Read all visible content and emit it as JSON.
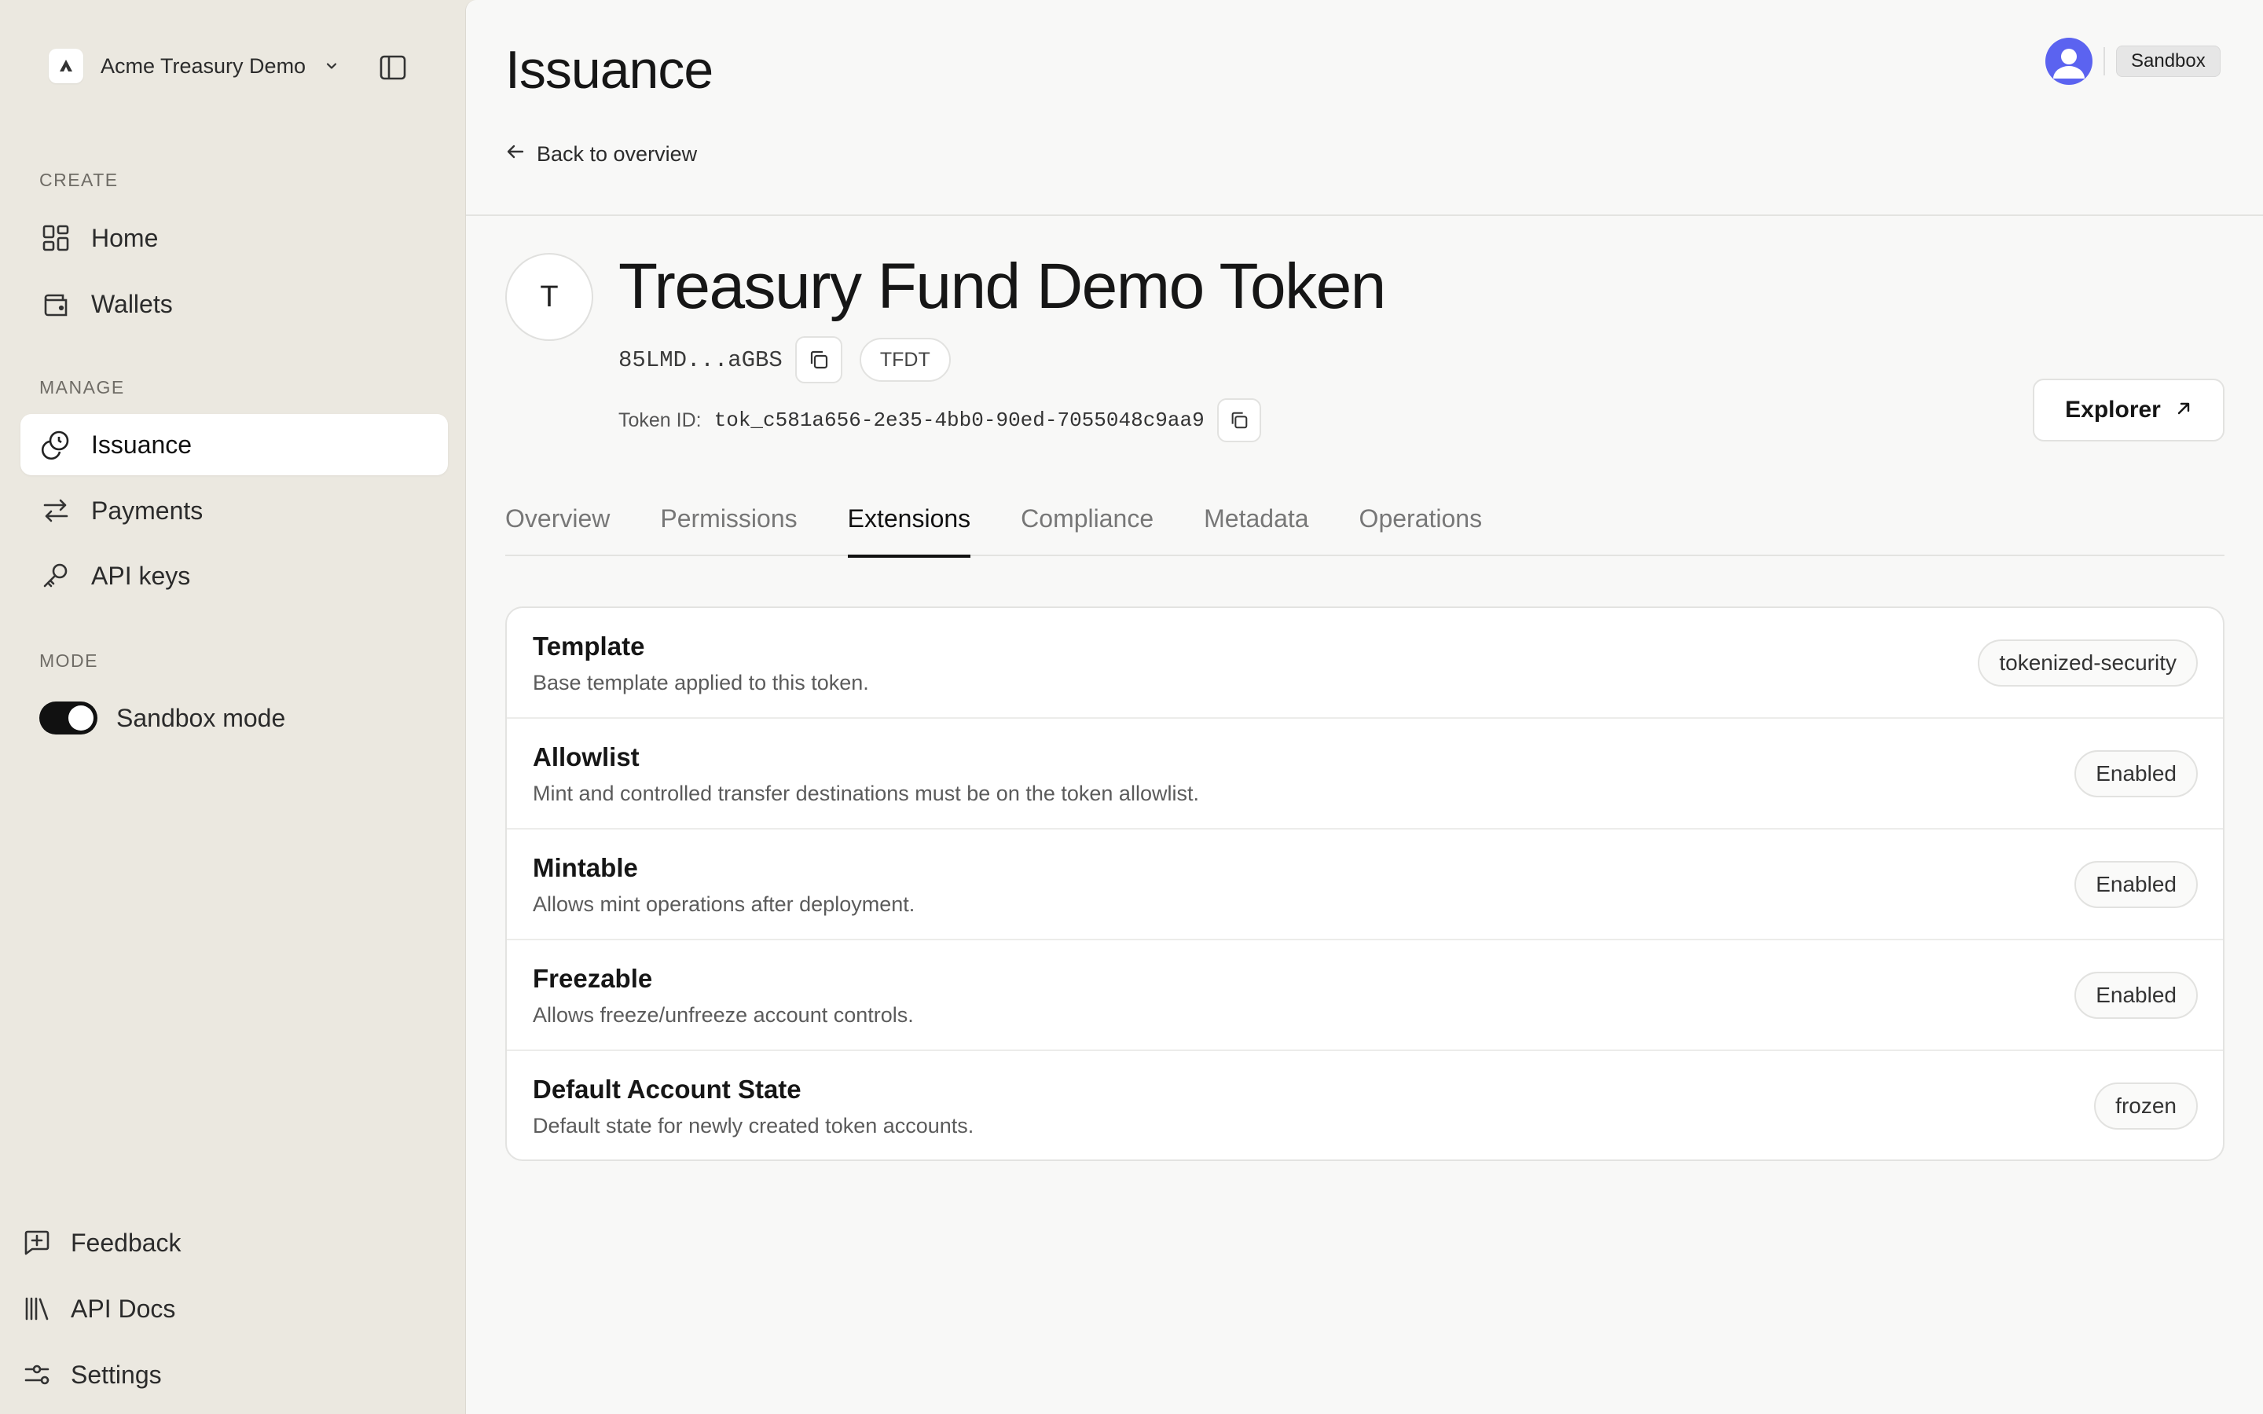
{
  "sidebar": {
    "org_logo": "A",
    "org_name": "Acme Treasury Demo",
    "sections": {
      "create": "CREATE",
      "manage": "MANAGE",
      "mode": "MODE"
    },
    "items": {
      "home": "Home",
      "wallets": "Wallets",
      "issuance": "Issuance",
      "payments": "Payments",
      "api_keys": "API keys"
    },
    "sandbox_mode_label": "Sandbox mode",
    "sandbox_mode_on": true,
    "bottom": {
      "feedback": "Feedback",
      "api_docs": "API Docs",
      "settings": "Settings"
    }
  },
  "header": {
    "title": "Issuance",
    "back_label": "Back to overview",
    "env_badge": "Sandbox"
  },
  "token": {
    "initial": "T",
    "name": "Treasury Fund Demo Token",
    "address_short": "85LMD...aGBS",
    "symbol": "TFDT",
    "token_id_label": "Token ID:",
    "token_id": "tok_c581a656-2e35-4bb0-90ed-7055048c9aa9",
    "explorer_label": "Explorer"
  },
  "tabs": [
    {
      "label": "Overview",
      "active": false
    },
    {
      "label": "Permissions",
      "active": false
    },
    {
      "label": "Extensions",
      "active": true
    },
    {
      "label": "Compliance",
      "active": false
    },
    {
      "label": "Metadata",
      "active": false
    },
    {
      "label": "Operations",
      "active": false
    }
  ],
  "extensions": [
    {
      "title": "Template",
      "description": "Base template applied to this token.",
      "value": "tokenized-security"
    },
    {
      "title": "Allowlist",
      "description": "Mint and controlled transfer destinations must be on the token allowlist.",
      "value": "Enabled"
    },
    {
      "title": "Mintable",
      "description": "Allows mint operations after deployment.",
      "value": "Enabled"
    },
    {
      "title": "Freezable",
      "description": "Allows freeze/unfreeze account controls.",
      "value": "Enabled"
    },
    {
      "title": "Default Account State",
      "description": "Default state for newly created token accounts.",
      "value": "frozen"
    }
  ],
  "colors": {
    "sidebar_bg": "#ebe8e0",
    "main_bg": "#f8f8f7",
    "avatar": "#5b63f0",
    "toggle_on": "#111111"
  }
}
